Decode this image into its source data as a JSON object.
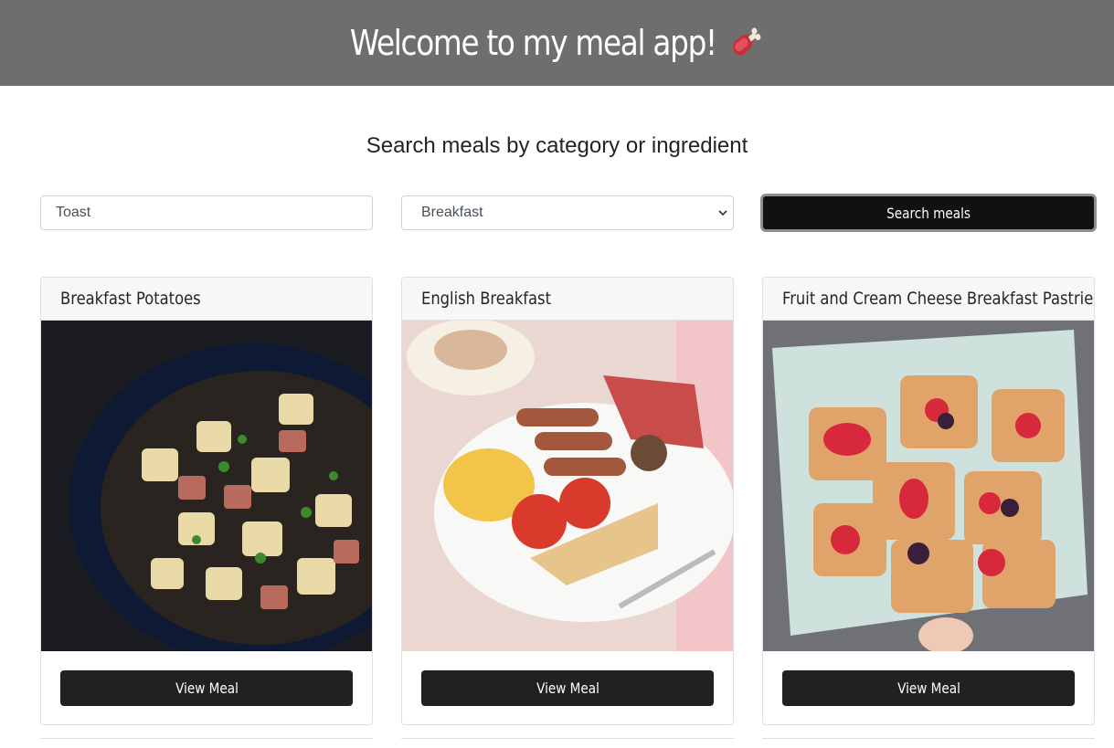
{
  "header": {
    "title": "Welcome to my meal app!",
    "icon": "meat-on-bone-icon"
  },
  "search": {
    "heading": "Search meals by category or ingredient",
    "ingredient_value": "Toast",
    "category_selected": "Breakfast",
    "button_label": "Search meals"
  },
  "meals": [
    {
      "name": "Breakfast Potatoes",
      "button": "View Meal"
    },
    {
      "name": "English Breakfast",
      "button": "View Meal"
    },
    {
      "name": "Fruit and Cream Cheese Breakfast Pastries",
      "button": "View Meal"
    }
  ],
  "colors": {
    "header_bg": "#6e6e6e",
    "button_bg": "#212121",
    "search_button_bg": "#111111"
  }
}
